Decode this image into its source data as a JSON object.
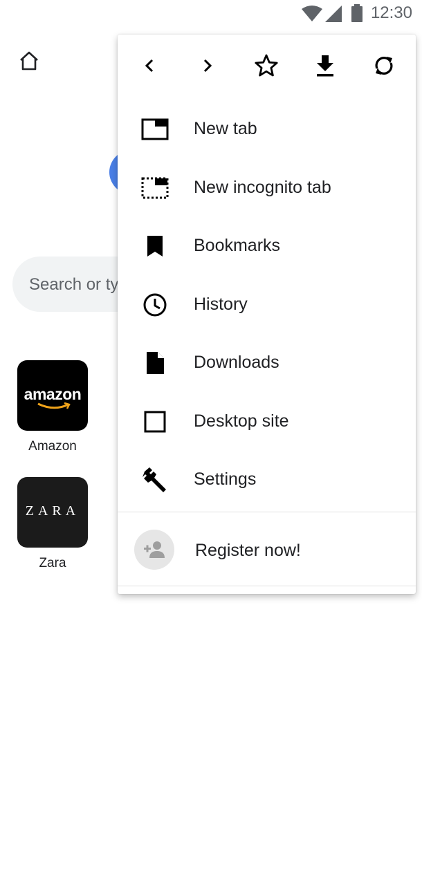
{
  "status_bar": {
    "time": "12:30"
  },
  "search": {
    "placeholder": "Search or type web address"
  },
  "shortcuts": [
    {
      "label": "Amazon",
      "logo_text": "amazon"
    },
    {
      "label": "Zara",
      "logo_text": "ZARA"
    }
  ],
  "menu": {
    "toolbar": [
      "back-icon",
      "forward-icon",
      "star-icon",
      "download-icon",
      "refresh-icon"
    ],
    "items": [
      {
        "label": "New tab",
        "icon": "new-tab-icon"
      },
      {
        "label": "New incognito tab",
        "icon": "incognito-tab-icon"
      },
      {
        "label": "Bookmarks",
        "icon": "bookmark-icon"
      },
      {
        "label": "History",
        "icon": "clock-icon"
      },
      {
        "label": "Downloads",
        "icon": "file-icon"
      },
      {
        "label": "Desktop site",
        "icon": "checkbox-icon"
      },
      {
        "label": "Settings",
        "icon": "wrench-icon"
      }
    ],
    "register_label": "Register now!"
  },
  "colors": {
    "accent_blue": "#4a7fe6",
    "search_bg": "#f1f3f4",
    "icon": "#000000"
  }
}
